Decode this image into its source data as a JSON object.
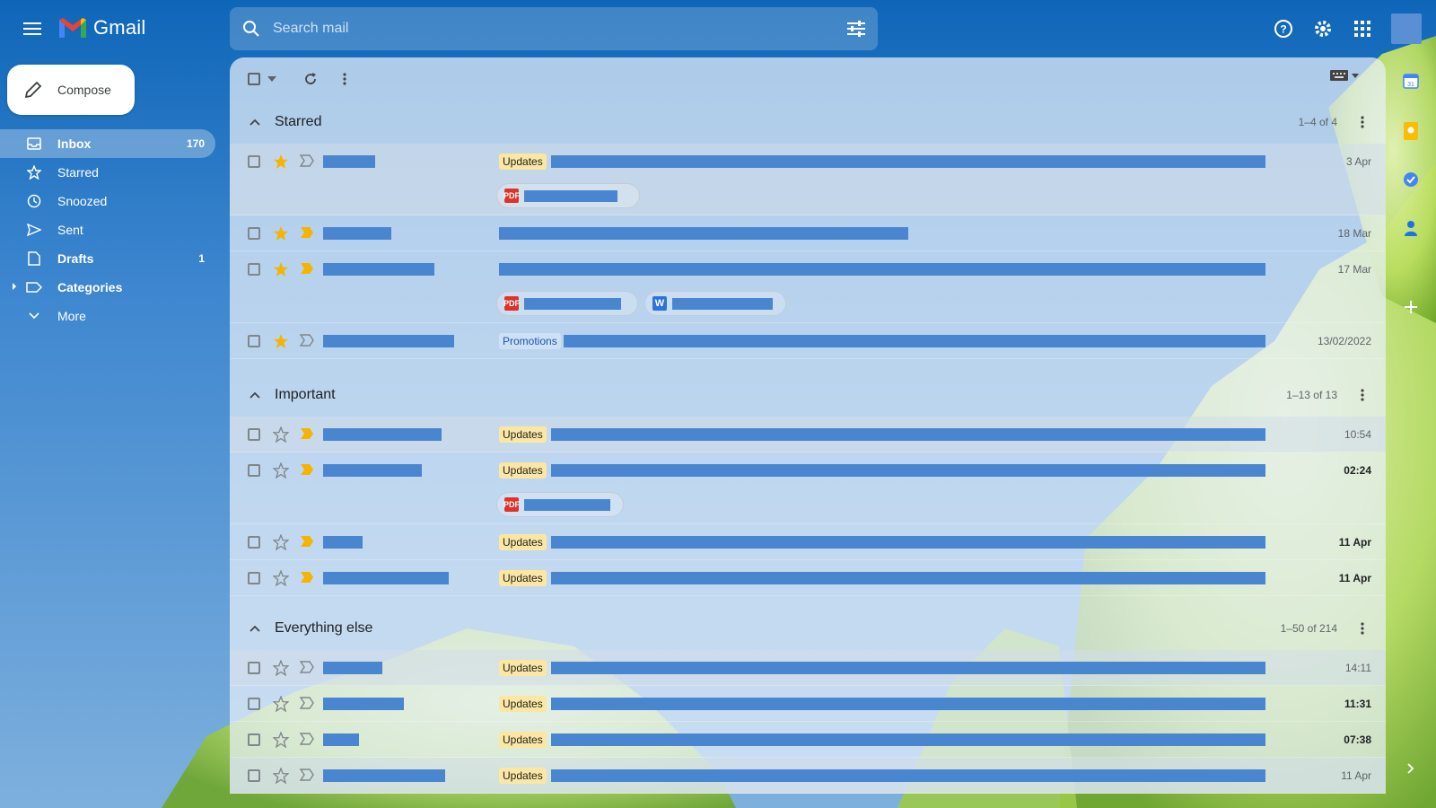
{
  "app": {
    "name": "Gmail"
  },
  "search": {
    "placeholder": "Search mail"
  },
  "compose": {
    "label": "Compose"
  },
  "nav": [
    {
      "label": "Inbox",
      "count": "170",
      "icon": "inbox-icon",
      "active": true
    },
    {
      "label": "Starred",
      "count": "",
      "icon": "star-icon"
    },
    {
      "label": "Snoozed",
      "count": "",
      "icon": "clock-icon"
    },
    {
      "label": "Sent",
      "count": "",
      "icon": "send-icon"
    },
    {
      "label": "Drafts",
      "count": "1",
      "icon": "draft-icon"
    },
    {
      "label": "Categories",
      "count": "",
      "icon": "label-icon"
    },
    {
      "label": "More",
      "count": "",
      "icon": "chevron-down-icon"
    }
  ],
  "sections": {
    "starred": {
      "title": "Starred",
      "range": "1–4 of 4"
    },
    "important": {
      "title": "Important",
      "range": "1–13 of 13"
    },
    "everything": {
      "title": "Everything else",
      "range": "1–50 of 214"
    }
  },
  "rows": {
    "s1": {
      "label": "Updates",
      "date": "3 Apr"
    },
    "s2": {
      "date": "18 Mar"
    },
    "s3": {
      "date": "17 Mar"
    },
    "s4": {
      "label": "Promotions",
      "date": "13/02/2022"
    },
    "i1": {
      "label": "Updates",
      "date": "10:54"
    },
    "i2": {
      "label": "Updates",
      "date": "02:24"
    },
    "i3": {
      "label": "Updates",
      "date": "11 Apr"
    },
    "i4": {
      "label": "Updates",
      "date": "11 Apr"
    },
    "e1": {
      "label": "Updates",
      "date": "14:11"
    },
    "e2": {
      "label": "Updates",
      "date": "11:31"
    },
    "e3": {
      "label": "Updates",
      "date": "07:38"
    },
    "e4": {
      "label": "Updates",
      "date": "11 Apr"
    }
  },
  "attachments": {
    "pdf_label": "PDF",
    "word_label": "W"
  },
  "colors": {
    "accent": "#4a86cf",
    "updates_chip": "#fbe7a3",
    "star": "#f4b400",
    "important": "#f4b400"
  }
}
